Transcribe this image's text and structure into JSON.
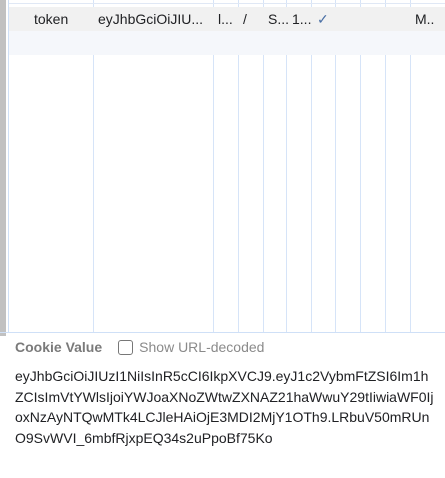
{
  "cookies_table": {
    "rows": [
      {
        "name": "token",
        "value": "eyJhbGciOiJIU...",
        "domain": "l...",
        "path": "/",
        "expires": "S...",
        "size": "1...",
        "http_only": "✓",
        "priority": "M.."
      }
    ]
  },
  "cookie_value_panel": {
    "title": "Cookie Value",
    "show_url_decoded_label": "Show URL-decoded",
    "show_url_decoded_checked": false,
    "value": "eyJhbGciOiJIUzI1NiIsInR5cCI6IkpXVCJ9.eyJ1c2VybmFtZSI6Im1hZCIsImVtYWlsIjoiYWJoaXNoZWtwZXNAZ21haWwuY29tIiwiaWF0IjoxNzAyNTQwMTk4LCJleHAiOjE3MDI2MjY1OTh9.LRbuV50mRUnO9SvWVI_6mbfRjxpEQ34s2uPpoBf75Ko"
  },
  "colors": {
    "http_only_check": "#4a6fa5",
    "grid_line": "#d6e4f8",
    "selected_row": "#f1f1f1"
  }
}
